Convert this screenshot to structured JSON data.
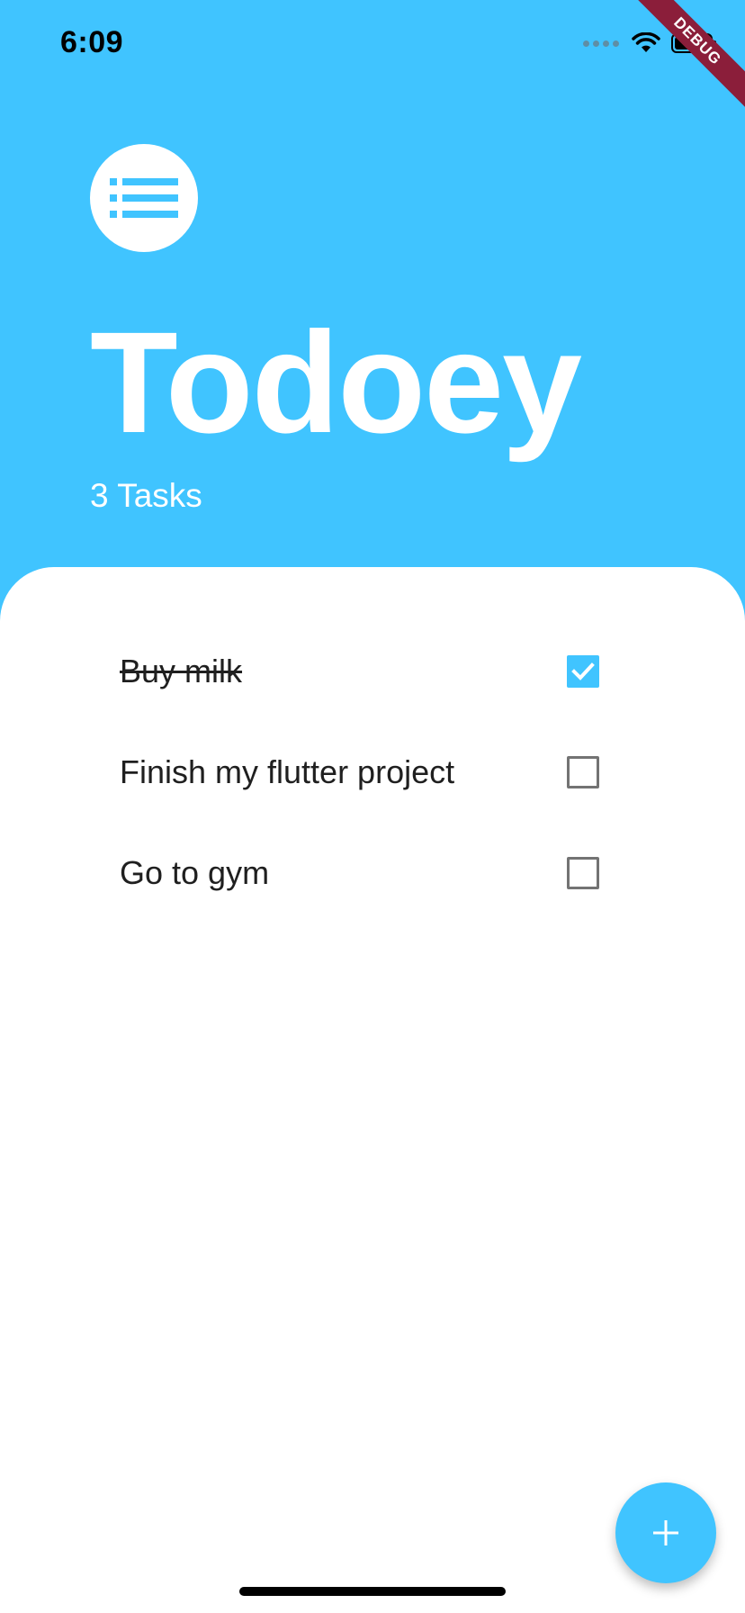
{
  "status_bar": {
    "time": "6:09",
    "icons": [
      "signal-icon",
      "wifi-icon",
      "battery-icon"
    ]
  },
  "debug_banner": "DEBUG",
  "header": {
    "icon": "list-icon",
    "title": "Todoey",
    "task_count": "3 Tasks"
  },
  "tasks": [
    {
      "label": "Buy milk",
      "done": true
    },
    {
      "label": "Finish my flutter project",
      "done": false
    },
    {
      "label": "Go to gym",
      "done": false
    }
  ],
  "fab": {
    "icon": "add-icon"
  },
  "colors": {
    "accent": "#40c4ff",
    "sheet": "#ffffff",
    "text": "#1f1f1f",
    "checkbox_border": "#737373",
    "debug_banner": "#8b1e3a"
  }
}
